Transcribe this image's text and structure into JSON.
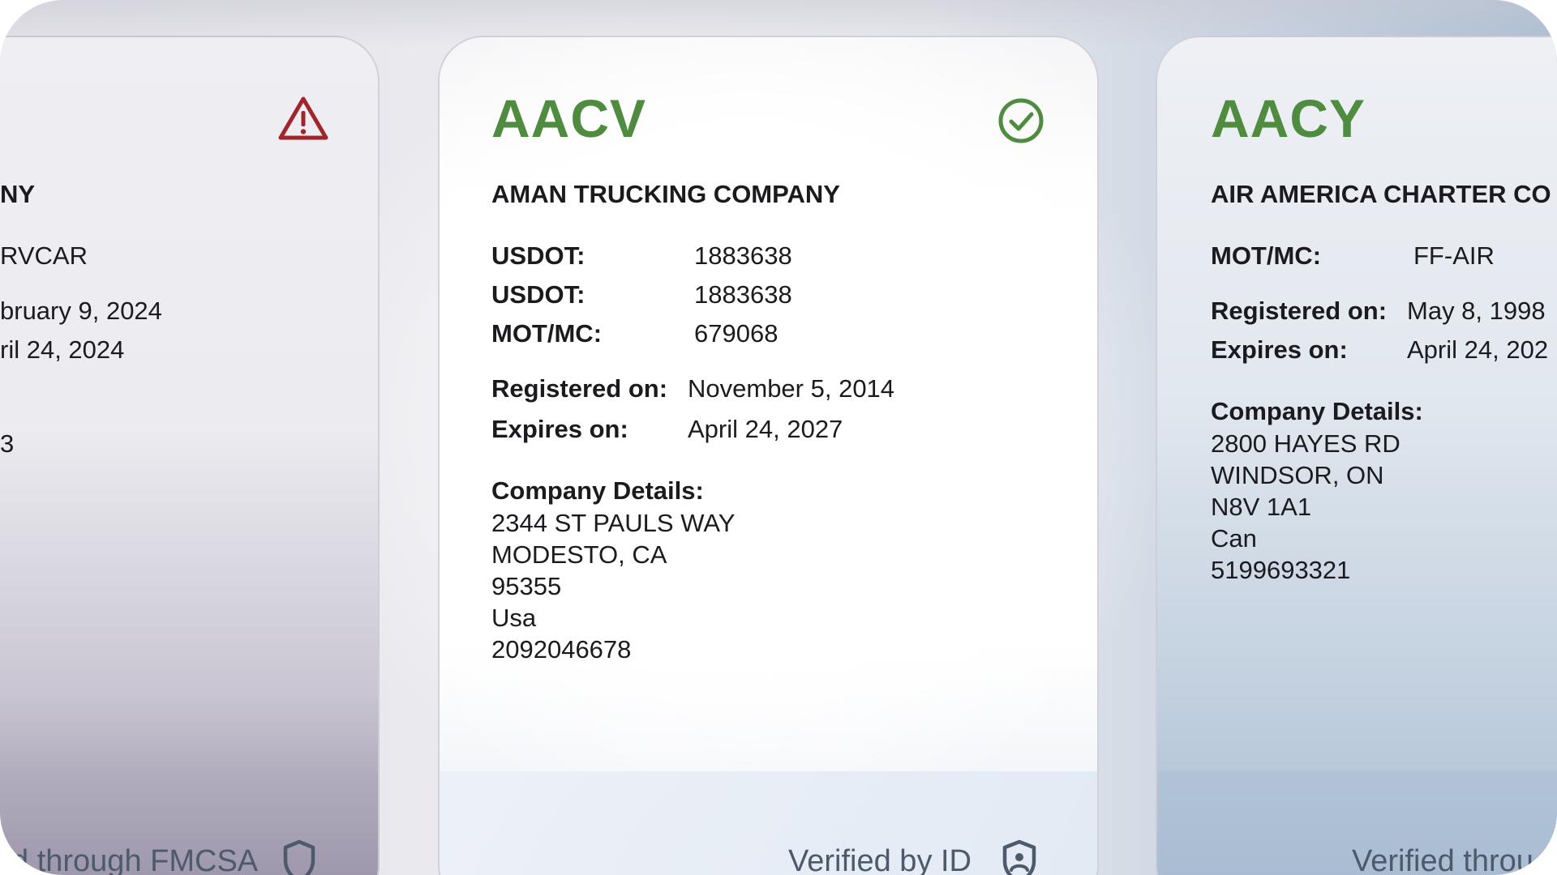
{
  "left_card": {
    "company_name": "NY",
    "line1": "RVCAR",
    "line2": "bruary 9, 2024",
    "line3": "ril 24, 2024",
    "line4": "3",
    "footer_text": "d through FMCSA",
    "status_icon": "warning-triangle-icon",
    "status_color": "#a1262b"
  },
  "center_card": {
    "ticker": "AACV",
    "company_name": "AMAN TRUCKING COMPANY",
    "rows": [
      {
        "label": "USDOT:",
        "value": "1883638"
      },
      {
        "label": "USDOT:",
        "value": "1883638"
      },
      {
        "label": "MOT/MC:",
        "value": "679068"
      }
    ],
    "registered_label": "Registered on:",
    "registered_value": "November 5, 2014",
    "expires_label": "Expires on:",
    "expires_value": "April 24, 2027",
    "details_title": "Company Details:",
    "details": [
      "2344 ST PAULS WAY",
      "MODESTO, CA",
      "95355",
      "Usa",
      "2092046678"
    ],
    "footer_text": "Verified by ID",
    "status_icon": "check-circle-icon",
    "status_color": "#4f8c3f"
  },
  "right_card": {
    "ticker": "AACY",
    "company_name": "AIR AMERICA CHARTER CO",
    "rows": [
      {
        "label": "MOT/MC:",
        "value": "FF-AIR"
      }
    ],
    "registered_label": "Registered on:",
    "registered_value": "May 8, 1998",
    "expires_label": "Expires on:",
    "expires_value": "April 24, 202",
    "details_title": "Company Details:",
    "details": [
      "2800 HAYES RD",
      "WINDSOR, ON",
      "N8V 1A1",
      "Can",
      "5199693321"
    ],
    "footer_text": "Verified throu"
  },
  "colors": {
    "ticker_green": "#4f8c3f",
    "warning_red": "#a1262b",
    "footer_text": "#4d5a6c",
    "shield_stroke": "#4d5a6c"
  }
}
